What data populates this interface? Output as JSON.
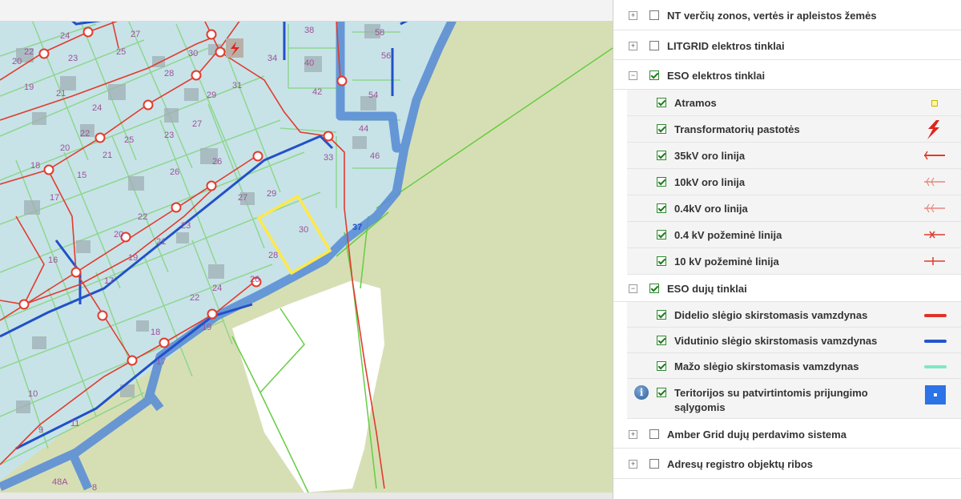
{
  "map": {
    "parcel_labels": [
      "22",
      "20",
      "24",
      "23",
      "27",
      "25",
      "30",
      "28",
      "19",
      "21",
      "24",
      "31",
      "29",
      "22",
      "25",
      "27",
      "20",
      "23",
      "26",
      "18",
      "15",
      "26",
      "17",
      "21",
      "22",
      "27",
      "29",
      "20",
      "23",
      "21",
      "16",
      "19",
      "28",
      "30",
      "17",
      "24",
      "22",
      "26",
      "18",
      "19",
      "17",
      "10",
      "11",
      "9",
      "48A",
      "8",
      "34",
      "40",
      "42",
      "54",
      "44",
      "46",
      "33",
      "56",
      "58",
      "38"
    ],
    "street_label": "37",
    "colors": {
      "land": "#d6dfb4",
      "parcel_fill": "#c7e3e8",
      "parcel_border": "#8fd68f",
      "power_line": "#e23b2e",
      "gas_pipe": "#2255cc",
      "corridor": "#5b8fd6",
      "selected_parcel": "#ffe84a"
    },
    "transformer_icon": "transformer-icon",
    "pole_icon": "pole-icon"
  },
  "legend": {
    "top_groups_before": [
      {
        "label": "NT verčių zonos, vertės ir apleistos žemės",
        "checked": false,
        "expander": "+"
      },
      {
        "label": "LITGRID elektros tinklai",
        "checked": false,
        "expander": "+"
      },
      {
        "label": "ESO elektros tinklai",
        "checked": true,
        "expander": "−"
      }
    ],
    "electric_items": [
      {
        "label": "Atramos",
        "checked": true,
        "symbol": "pole-square-icon"
      },
      {
        "label": "Transformatorių pastotės",
        "checked": true,
        "symbol": "lightning-icon"
      },
      {
        "label": "35kV oro linija",
        "checked": true,
        "symbol": "line-35kv-icon"
      },
      {
        "label": "10kV oro linija",
        "checked": true,
        "symbol": "line-10kv-icon"
      },
      {
        "label": "0.4kV oro linija",
        "checked": true,
        "symbol": "line-04kv-icon"
      },
      {
        "label": "0.4 kV požeminė linija",
        "checked": true,
        "symbol": "line-04kv-underground-icon"
      },
      {
        "label": "10 kV požeminė linija",
        "checked": true,
        "symbol": "line-10kv-underground-icon"
      }
    ],
    "gas_group": {
      "label": "ESO dujų tinklai",
      "checked": true,
      "expander": "−"
    },
    "gas_items": [
      {
        "label": "Didelio slėgio skirstomasis vamzdynas",
        "checked": true,
        "color": "#e0312a"
      },
      {
        "label": "Vidutinio slėgio skirstomasis vamzdynas",
        "checked": true,
        "color": "#2455cf"
      },
      {
        "label": "Mažo slėgio skirstomasis vamzdynas",
        "checked": true,
        "color": "#7de8c4"
      }
    ],
    "territory_item": {
      "label_line1": "Teritorijos su patvirtintomis prijungimo",
      "label_line2": "sąlygomis",
      "checked": true,
      "info": "i",
      "color": "#2b73e6"
    },
    "top_groups_after": [
      {
        "label": "Amber Grid dujų perdavimo sistema",
        "checked": false,
        "expander": "+"
      },
      {
        "label": "Adresų registro objektų ribos",
        "checked": false,
        "expander": "+"
      }
    ]
  }
}
